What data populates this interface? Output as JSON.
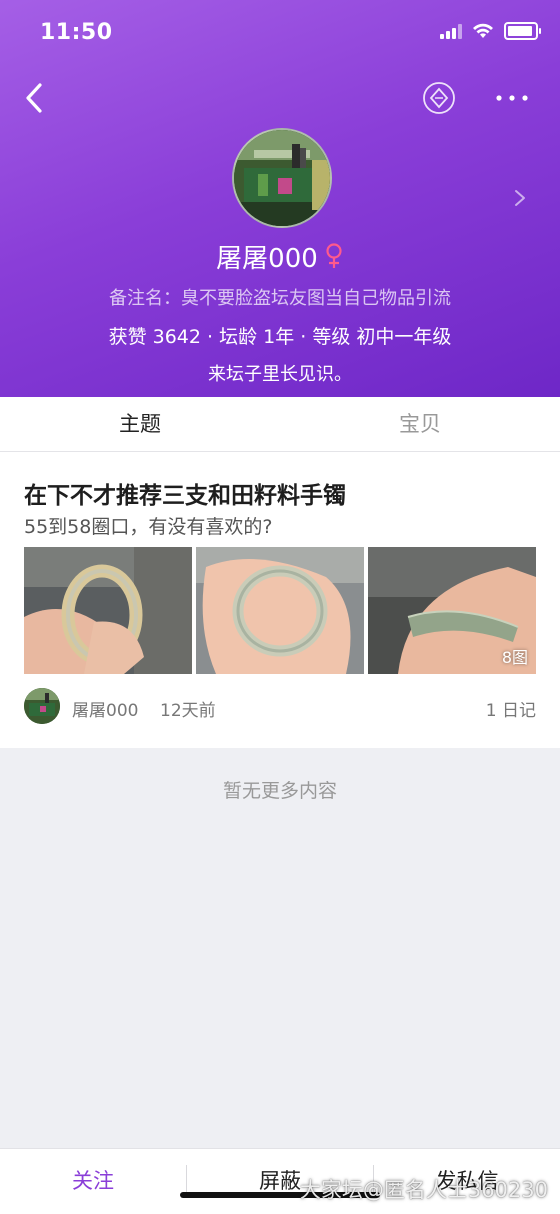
{
  "status_bar": {
    "time": "11:50"
  },
  "header": {
    "nav": {
      "back_icon": "chevron-left-icon",
      "coin_icon": "diamond-coin-icon",
      "more_icon": "more-dots-icon"
    },
    "profile": {
      "name": "屠屠000",
      "gender_icon": "female-icon",
      "remark": "备注名：臭不要脸盗坛友图当自己物品引流",
      "stats": "获赞 3642 · 坛龄 1年 · 等级 初中一年级",
      "bio": "来坛子里长见识。"
    },
    "colors": {
      "gradient_start": "#a55fe6",
      "gradient_end": "#6e27c7",
      "gender": "#ff5a8c"
    }
  },
  "tabs": [
    {
      "label": "主题",
      "active": true
    },
    {
      "label": "宝贝",
      "active": false
    }
  ],
  "post": {
    "title": "在下不才推荐三支和田籽料手镯",
    "subtitle": "55到58圈口，有没有喜欢的?",
    "image_count": "8图",
    "author": "屠屠000",
    "time": "12天前",
    "diary": "1 日记"
  },
  "empty_text": "暂无更多内容",
  "bottom_bar": {
    "follow": "关注",
    "block": "屏蔽",
    "message": "发私信",
    "accent": "#8a3ed8"
  },
  "watermark": "大家坛@匿名人士360230"
}
